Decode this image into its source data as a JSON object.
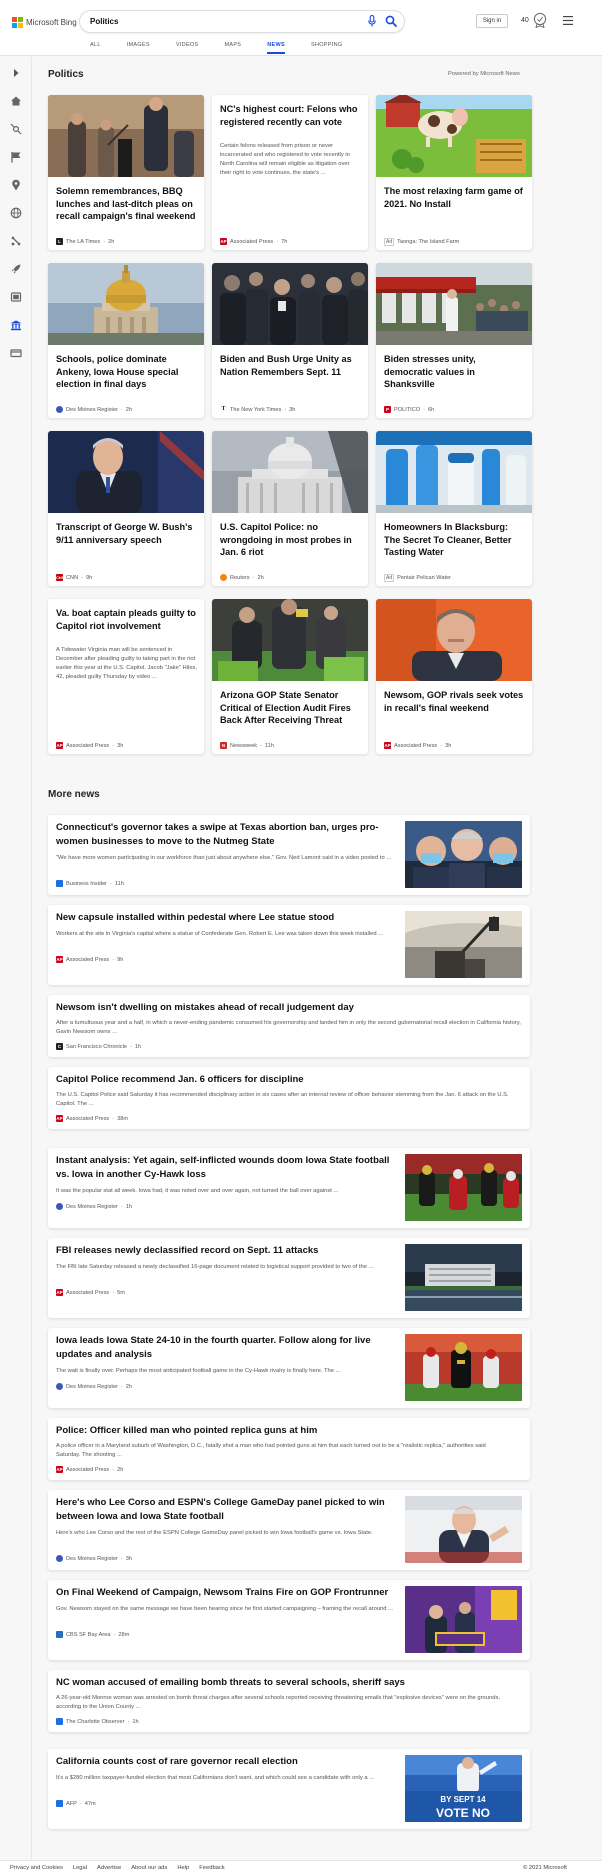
{
  "header": {
    "brand": "Microsoft Bing",
    "brand_colors": [
      "#f25022",
      "#7fba00",
      "#00a4ef",
      "#ffb900"
    ],
    "search_value": "Politics",
    "sign_in": "Sign in",
    "points": "40",
    "accent": "#174ae4",
    "icons": [
      "mic-icon",
      "search-icon",
      "rewards-icon",
      "hamburger-menu-icon"
    ]
  },
  "tabs": [
    "ALL",
    "IMAGES",
    "VIDEOS",
    "MAPS",
    "NEWS",
    "SHOPPING"
  ],
  "active_tab": "NEWS",
  "rail_icons": [
    "expand-icon",
    "home-icon",
    "sports-icon",
    "flag-icon",
    "location-icon",
    "world-icon",
    "science-icon",
    "rocket-icon",
    "entertainment-icon",
    "politics-icon",
    "money-icon"
  ],
  "section": {
    "title": "Politics",
    "powered_by": "Powered by Microsoft News"
  },
  "cards": [
    {
      "title": "Solemn remembrances, BBQ lunches and last-ditch pleas on recall campaign's final weekend",
      "snippet": "",
      "source": "The LA Times",
      "time": "2h",
      "ad": false,
      "has_image": true,
      "src_color": "#222222"
    },
    {
      "title": "NC's highest court: Felons who registered recently can vote",
      "snippet": "Certain felons released from prison or never incarcerated and who registered to vote recently in North Carolina will remain eligible as litigation over their right to vote continues, the state's ...",
      "source": "Associated Press",
      "time": "7h",
      "ad": false,
      "has_image": false,
      "src_color": "#d0021b"
    },
    {
      "title": "The most relaxing farm game of 2021. No Install",
      "snippet": "",
      "source": "Taonga: The Island Farm",
      "time": "",
      "ad": true,
      "ad_label": "Ad",
      "has_image": true,
      "src_color": "#999999"
    },
    {
      "title": "Schools, police dominate Ankeny, Iowa House special election in final days",
      "snippet": "",
      "source": "Des Moines Register",
      "time": "2h",
      "ad": false,
      "has_image": true,
      "src_color": "#3b5ab8"
    },
    {
      "title": "Biden and Bush Urge Unity as Nation Remembers Sept. 11",
      "snippet": "",
      "source": "The New York Times",
      "time": "3h",
      "ad": false,
      "has_image": true,
      "src_color": "#222222"
    },
    {
      "title": "Biden stresses unity, democratic values in Shanksville",
      "snippet": "",
      "source": "POLITICO",
      "time": "6h",
      "ad": false,
      "has_image": true,
      "src_color": "#d0021b"
    },
    {
      "title": "Transcript of George W. Bush's 9/11 anniversary speech",
      "snippet": "",
      "source": "CNN",
      "time": "9h",
      "ad": false,
      "has_image": true,
      "src_color": "#cc0000"
    },
    {
      "title": "U.S. Capitol Police: no wrongdoing in most probes in Jan. 6 riot",
      "snippet": "",
      "source": "Reuters",
      "time": "2h",
      "ad": false,
      "has_image": true,
      "src_color": "#f58220"
    },
    {
      "title": "Homeowners In Blacksburg: The Secret To Cleaner, Better Tasting Water",
      "snippet": "",
      "source": "Pentair Pelican Water",
      "time": "",
      "ad": true,
      "ad_label": "Ad",
      "has_image": true,
      "src_color": "#999999"
    },
    {
      "title": "Va. boat captain pleads guilty to Capitol riot involvement",
      "snippet": "A Tidewater Virginia man will be sentenced in December after pleading guilty to taking part in the riot earlier this year at the U.S. Capitol. Jacob \"Jake\" Hiles, 42, pleaded guilty Thursday by video ...",
      "source": "Associated Press",
      "time": "3h",
      "ad": false,
      "has_image": false,
      "src_color": "#d0021b"
    },
    {
      "title": "Arizona GOP State Senator Critical of Election Audit Fires Back After Receiving Threat",
      "snippet": "",
      "source": "Newsweek",
      "time": "11h",
      "ad": false,
      "has_image": true,
      "src_color": "#d8232a"
    },
    {
      "title": "Newsom, GOP rivals seek votes in recall's final weekend",
      "snippet": "",
      "source": "Associated Press",
      "time": "3h",
      "ad": false,
      "has_image": true,
      "src_color": "#d0021b"
    }
  ],
  "more_news": {
    "title": "More news",
    "items": [
      {
        "title": "Connecticut's governor takes a swipe at Texas abortion ban, urges pro-women businesses to move to the Nutmeg State",
        "snippet": "\"We have more women participating in our workforce than just about anywhere else,\" Gov. Ned Lamont said in a video posted to ...",
        "source": "Business Insider",
        "time": "11h",
        "has_image": true,
        "src_color": "#1f6fe0"
      },
      {
        "title": "New capsule installed within pedestal where Lee statue stood",
        "snippet": "Workers at the site in Virginia's capital where a statue of Confederate Gen. Robert E. Lee was taken down this week installed ...",
        "source": "Associated Press",
        "time": "9h",
        "has_image": true,
        "src_color": "#d0021b"
      },
      {
        "title": "Newsom isn't dwelling on mistakes ahead of recall judgement day",
        "snippet": "After a tumultuous year and a half, in which a never-ending pandemic consumed his governorship and landed him in only the second gubernatorial recall election in California history, Gavin Newsom owns ...",
        "source": "San Francisco Chronicle",
        "time": "1h",
        "has_image": false,
        "src_color": "#222222"
      },
      {
        "title": "Capitol Police recommend Jan. 6 officers for discipline",
        "snippet": "The U.S. Capitol Police said Saturday it has recommended disciplinary action in six cases after an internal review of officer behavior stemming from the Jan. 6 attack on the U.S. Capitol. The ...",
        "source": "Associated Press",
        "time": "38m",
        "has_image": false,
        "src_color": "#d0021b"
      },
      {
        "title": "Instant analysis: Yet again, self-inflicted wounds doom Iowa State football vs. Iowa in another Cy-Hawk loss",
        "snippet": "It was the popular stat all week. Iowa had, it was noted over and over again, not turned the ball over against ...",
        "source": "Des Moines Register",
        "time": "1h",
        "has_image": true,
        "src_color": "#3b5ab8"
      },
      {
        "title": "FBI releases newly declassified record on Sept. 11 attacks",
        "snippet": "The FBI late Saturday released a newly declassified 16-page document related to logistical support provided to two of the ...",
        "source": "Associated Press",
        "time": "5m",
        "has_image": true,
        "src_color": "#d0021b"
      },
      {
        "title": "Iowa leads Iowa State 24-10 in the fourth quarter. Follow along for live updates and analysis",
        "snippet": "The wait is finally over.  Perhaps the most anticipated football game in the Cy-Hawk rivalry is finally here. The ...",
        "source": "Des Moines Register",
        "time": "2h",
        "has_image": true,
        "src_color": "#3b5ab8"
      },
      {
        "title": "Police: Officer killed man who pointed replica guns at him",
        "snippet": "A police officer in a Maryland suburb of Washington, D.C., fatally shot a man who had pointed guns at him that each turned out to be a \"realistic replica,\" authorities said Saturday. The shooting ...",
        "source": "Associated Press",
        "time": "2h",
        "has_image": false,
        "src_color": "#d0021b"
      },
      {
        "title": "Here's who Lee Corso and ESPN's College GameDay panel picked to win between Iowa and Iowa State football",
        "snippet": "Here's who Lee Corso and the rest of the ESPN College GameDay panel picked to win Iowa football's game vs. Iowa State.",
        "source": "Des Moines Register",
        "time": "3h",
        "has_image": true,
        "src_color": "#3b5ab8"
      },
      {
        "title": "On Final Weekend of Campaign, Newsom Trains Fire on GOP Frontrunner",
        "snippet": "Gov. Newsom stayed on the same message we have been hearing since he first started campaigning – framing the recall around ...",
        "source": "CBS SF Bay Area",
        "time": "28m",
        "has_image": true,
        "src_color": "#2a6ebb"
      },
      {
        "title": "NC woman accused of emailing bomb threats to several schools, sheriff says",
        "snippet": "A 26-year-old Monroe woman was arrested on bomb threat charges after several schools reported receiving threatening emails that \"explosive devices\" were on the grounds, according to the Union County ...",
        "source": "The Charlotte Observer",
        "time": "1h",
        "has_image": false,
        "src_color": "#1f6fe0"
      },
      {
        "title": "California counts cost of rare governor recall election",
        "snippet": "It's a $280 million taxpayer-funded election that most Californians don't want, and which could see a candidate with only a ...",
        "source": "AFP",
        "time": "47m",
        "has_image": true,
        "src_color": "#1f6fe0",
        "image_text": {
          "line1": "BY SEPT 14",
          "line2": "VOTE NO"
        }
      }
    ]
  },
  "footer": {
    "links": [
      "Privacy and Cookies",
      "Legal",
      "Advertise",
      "About our ads",
      "Help",
      "Feedback"
    ],
    "copyright": "© 2021 Microsoft"
  }
}
